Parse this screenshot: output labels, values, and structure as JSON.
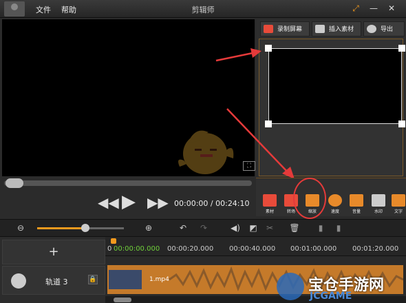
{
  "titlebar": {
    "menu": [
      "文件",
      "帮助"
    ],
    "title": "剪辑师",
    "controls": [
      "restore",
      "minimize",
      "close"
    ]
  },
  "right_tabs": [
    {
      "label": "录制屏幕",
      "icon": "camera-icon",
      "color": "#e84b3a"
    },
    {
      "label": "插入素材",
      "icon": "image-icon",
      "color": "#cccccc"
    },
    {
      "label": "导出",
      "icon": "film-reel-icon",
      "color": "#cccccc"
    }
  ],
  "player": {
    "current_time": "00:00:00",
    "separator": " / ",
    "total_time": "00:24:10",
    "seek_progress": 0.0
  },
  "tools": [
    {
      "label": "素材",
      "icon": "camera-icon",
      "color": "#e84b3a"
    },
    {
      "label": "转场",
      "icon": "transition-icon",
      "color": "#e84b3a"
    },
    {
      "label": "缩放",
      "icon": "zoom-frame-icon",
      "color": "#e88a2a"
    },
    {
      "label": "速度",
      "icon": "speed-icon",
      "color": "#e88a2a"
    },
    {
      "label": "音量",
      "icon": "volume-icon",
      "color": "#e88a2a"
    },
    {
      "label": "水印",
      "icon": "stamp-icon",
      "color": "#cccccc"
    },
    {
      "label": "文字",
      "icon": "pen-icon",
      "color": "#e88a2a"
    }
  ],
  "timeline": {
    "zoom_level": 0.55,
    "ruler": [
      "00:00:00.000",
      "00:00:20.000",
      "00:00:40.000",
      "00:01:00.000",
      "00:01:20.000"
    ],
    "playhead_label": "0",
    "add_track": "+",
    "track_name": "轨道 3",
    "clip_name": "1.mp4"
  },
  "watermark": {
    "text_cn": "宝仓手游网",
    "text_en": "JCGAME"
  },
  "colors": {
    "accent": "#f39a1e",
    "highlight_circle": "#e53a3a",
    "arrow": "#e53a3a"
  }
}
